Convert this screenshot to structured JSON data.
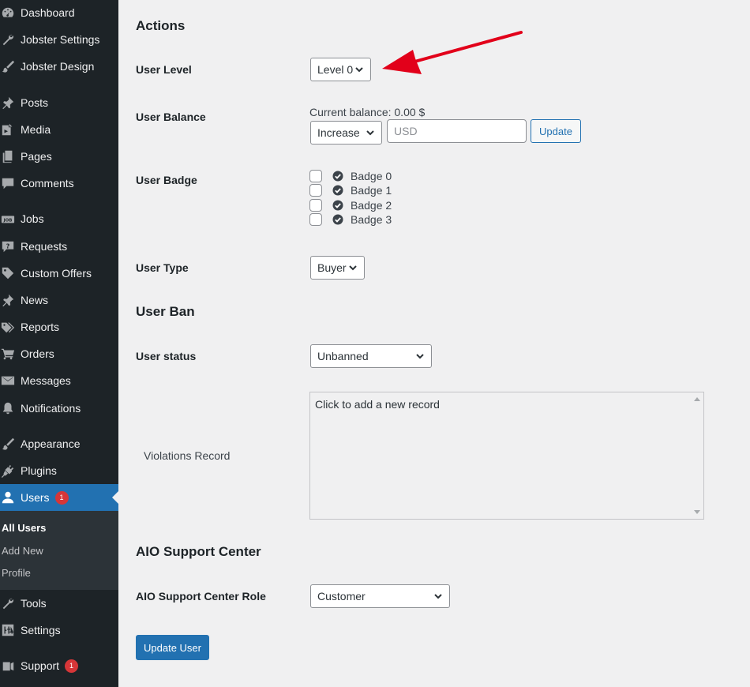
{
  "sidebar": {
    "items": [
      {
        "label": "Dashboard",
        "icon": "dashboard-icon"
      },
      {
        "label": "Jobster Settings",
        "icon": "wrench-icon"
      },
      {
        "label": "Jobster Design",
        "icon": "brush-icon"
      },
      {
        "label": "Posts",
        "icon": "pin-icon"
      },
      {
        "label": "Media",
        "icon": "media-icon"
      },
      {
        "label": "Pages",
        "icon": "pages-icon"
      },
      {
        "label": "Comments",
        "icon": "comment-icon"
      },
      {
        "label": "Jobs",
        "icon": "job-icon"
      },
      {
        "label": "Requests",
        "icon": "question-icon"
      },
      {
        "label": "Custom Offers",
        "icon": "tag-icon"
      },
      {
        "label": "News",
        "icon": "pin-icon"
      },
      {
        "label": "Reports",
        "icon": "tags-icon"
      },
      {
        "label": "Orders",
        "icon": "cart-icon"
      },
      {
        "label": "Messages",
        "icon": "envelope-icon"
      },
      {
        "label": "Notifications",
        "icon": "bell-icon"
      },
      {
        "label": "Appearance",
        "icon": "brush-icon"
      },
      {
        "label": "Plugins",
        "icon": "plugin-icon"
      },
      {
        "label": "Users",
        "icon": "user-icon",
        "badge": "1"
      },
      {
        "label": "Tools",
        "icon": "wrench-icon"
      },
      {
        "label": "Settings",
        "icon": "settings-icon"
      },
      {
        "label": "Support",
        "icon": "support-icon",
        "badge": "1"
      }
    ],
    "submenu": [
      "All Users",
      "Add New",
      "Profile"
    ]
  },
  "actions": {
    "title": "Actions",
    "user_level_label": "User Level",
    "user_level_value": "Level 0",
    "user_balance_label": "User Balance",
    "current_balance": "Current balance: 0.00 $",
    "balance_mode": "Increase",
    "balance_placeholder": "USD",
    "update_label": "Update",
    "user_badge_label": "User Badge",
    "badges": [
      "Badge 0",
      "Badge 1",
      "Badge 2",
      "Badge 3"
    ],
    "user_type_label": "User Type",
    "user_type_value": "Buyer"
  },
  "ban": {
    "title": "User Ban",
    "status_label": "User status",
    "status_value": "Unbanned",
    "violations_label": "Violations Record",
    "violations_text": "Click to add a new record"
  },
  "aio": {
    "title": "AIO Support Center",
    "role_label": "AIO Support Center Role",
    "role_value": "Customer"
  },
  "submit_label": "Update User",
  "colors": {
    "sidebar_bg": "#1d2327",
    "active_bg": "#2271b1",
    "badge_red": "#d63638",
    "arrow_red": "#e2001a"
  }
}
